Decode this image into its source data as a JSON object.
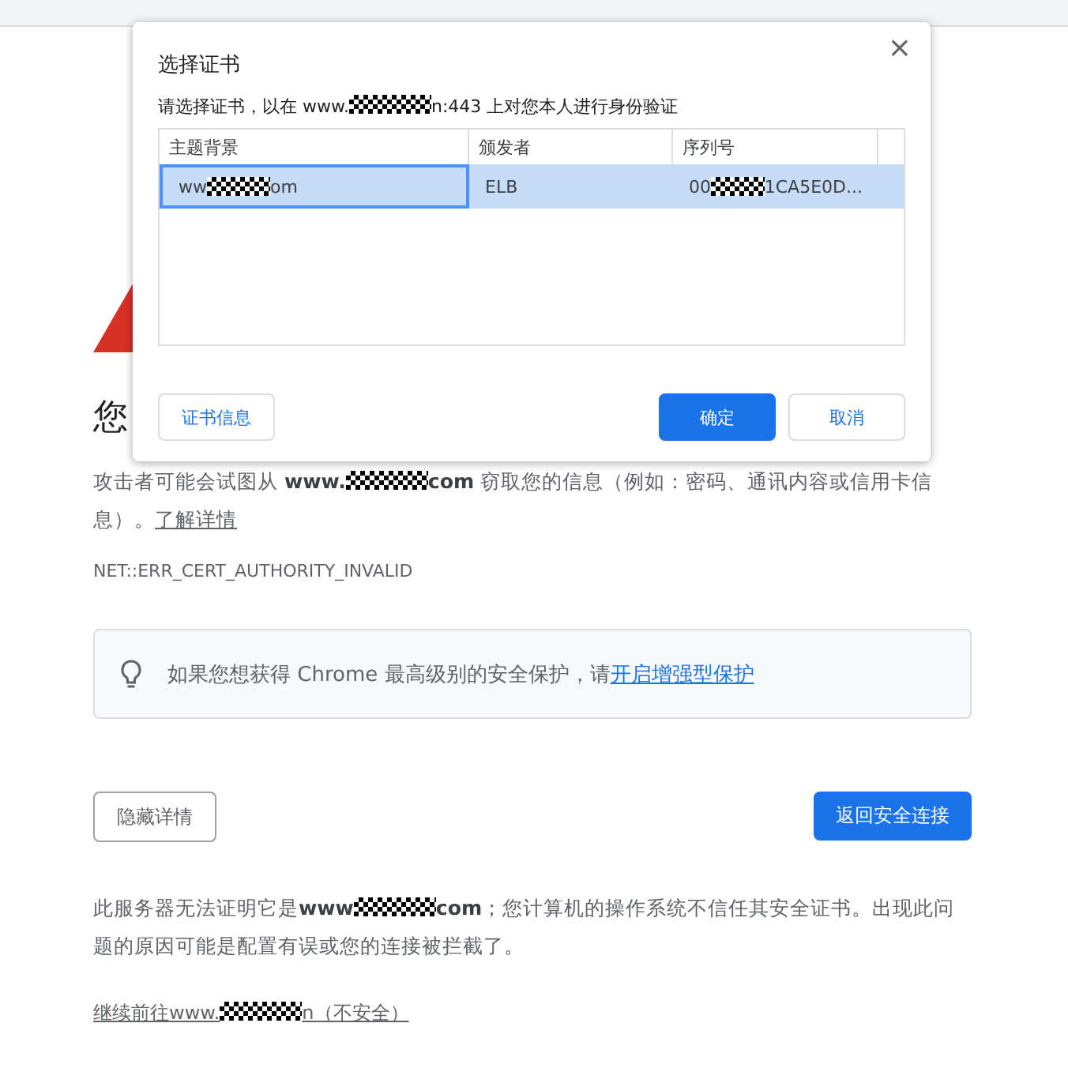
{
  "page": {
    "heading": "您",
    "paragraph": [
      {
        "text": "攻击者可能会试图从 **www.**"
      },
      {
        "kind": "mask"
      },
      {
        "text": "**com** 窃取您的信息（例如：密码、通讯内容或信用卡信息）。"
      }
    ],
    "learn_more_link": "了解详情",
    "error_code": "NET::ERR_CERT_AUTHORITY_INVALID",
    "tip": {
      "text": "如果您想获得 Chrome 最高级别的安全保护，请",
      "link": "开启增强型保护"
    },
    "hide_details_button": "隐藏详情",
    "back_button": "返回安全连接",
    "details": [
      {
        "text": "此服务器无法证明它是**www**"
      },
      {
        "kind": "mask"
      },
      {
        "text": "**com**；您计算机的操作系统不信任其安全证书。出现此问题的原因可能是配置有误或您的连接被拦截了。"
      }
    ],
    "proceed_link": [
      {
        "text": "继续前往www."
      },
      {
        "kind": "mask"
      },
      {
        "text": "n（不安全）"
      }
    ]
  },
  "dialog": {
    "title": "选择证书",
    "close": "×",
    "subtitle": [
      {
        "text": "请选择证书，以在 www."
      },
      {
        "kind": "mask"
      },
      {
        "text": "n:443 上对您本人进行身份验证"
      }
    ],
    "columns": [
      "主题背景",
      "颁发者",
      "序列号"
    ],
    "rows": [
      {
        "selected": true,
        "cells": [
          [
            {
              "text": "ww"
            },
            {
              "kind": "mask"
            },
            {
              "text": "om"
            }
          ],
          [
            {
              "text": "ELB"
            }
          ],
          [
            {
              "text": "00"
            },
            {
              "kind": "mask"
            },
            {
              "text": "1CA5E0D..."
            }
          ]
        ]
      }
    ],
    "buttons": [
      {
        "label": "证书信息",
        "kind": "plain"
      },
      {
        "label": "确定",
        "kind": "primary"
      },
      {
        "label": "取消",
        "kind": "plain"
      }
    ]
  }
}
